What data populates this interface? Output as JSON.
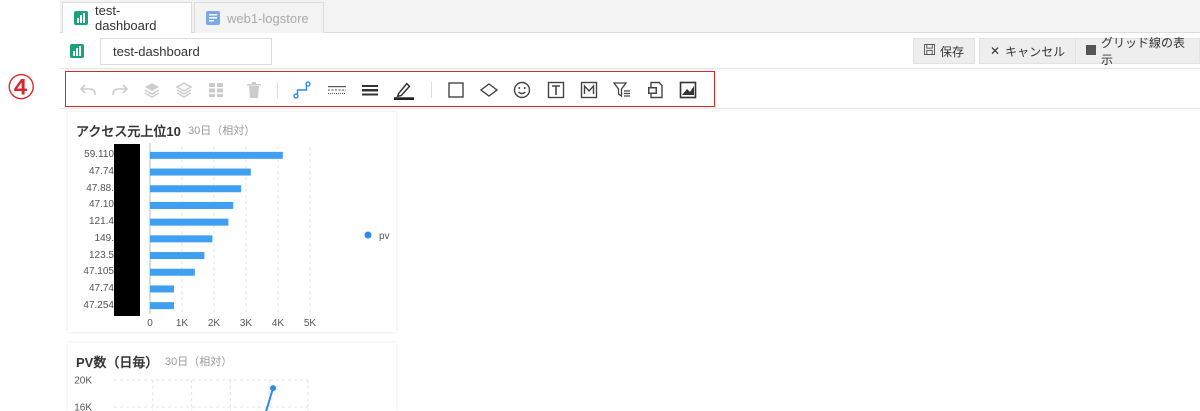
{
  "annotation": {
    "marker": "④",
    "color": "#d9262b"
  },
  "tabs": [
    {
      "label": "test-dashboard",
      "active": true
    },
    {
      "label": "web1-logstore",
      "active": false
    }
  ],
  "header": {
    "dashboard_name": "test-dashboard",
    "save_label": "保存",
    "cancel_label": "キャンセル",
    "grid_label": "グリッド線の表示"
  },
  "toolbar": {
    "items": [
      "undo-icon",
      "redo-icon",
      "bring-forward-icon",
      "send-backward-icon",
      "grid-layout-icon",
      "delete-icon",
      "connector-icon",
      "line-style-icon",
      "line-width-icon",
      "pen-color-icon",
      "rectangle-icon",
      "diamond-icon",
      "emoji-icon",
      "text-icon",
      "markdown-icon",
      "filter-icon",
      "copy-icon",
      "image-icon"
    ]
  },
  "chart1": {
    "title": "アクセス元上位10",
    "subtitle": "30日（相対）",
    "legend": "pv",
    "color": "#3fa0f2"
  },
  "chart2": {
    "title": "PV数（日毎）",
    "subtitle": "30日（相対）"
  },
  "chart_data": [
    {
      "type": "bar",
      "orientation": "horizontal",
      "title": "アクセス元上位10",
      "categories": [
        "59.110",
        "47.74",
        "47.88.",
        "47.10",
        "121.4",
        "149.",
        "123.5",
        "47.105",
        "47.74",
        "47.254"
      ],
      "series": [
        {
          "name": "pv",
          "values": [
            4150,
            3150,
            2850,
            2600,
            2450,
            1950,
            1700,
            1400,
            750,
            750
          ]
        }
      ],
      "xticks": [
        "0",
        "1K",
        "2K",
        "3K",
        "4K",
        "5K"
      ],
      "xlim": [
        0,
        5000
      ],
      "grid": true,
      "legend": "right"
    },
    {
      "type": "line",
      "title": "PV数（日毎）",
      "yticks": [
        "20K",
        "16K"
      ],
      "points": [
        {
          "x": 0.82,
          "y": 18800
        },
        {
          "x": 0.78,
          "y": 15000
        }
      ],
      "grid": true
    }
  ]
}
